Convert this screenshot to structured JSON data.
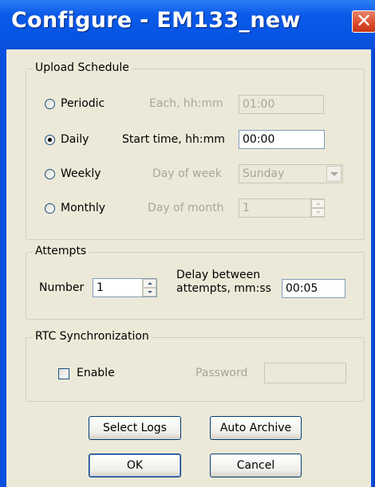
{
  "window": {
    "title": "Configure - EM133_new",
    "close_glyph": "✕"
  },
  "upload_schedule": {
    "title": "Upload Schedule",
    "options": [
      {
        "label": "Periodic",
        "param_label": "Each, hh:mm",
        "value": "01:00",
        "selected": false,
        "enabled": false
      },
      {
        "label": "Daily",
        "param_label": "Start time, hh:mm",
        "value": "00:00",
        "selected": true,
        "enabled": true
      },
      {
        "label": "Weekly",
        "param_label": "Day of week",
        "value": "Sunday",
        "selected": false,
        "enabled": false
      },
      {
        "label": "Monthly",
        "param_label": "Day of month",
        "value": "1",
        "selected": false,
        "enabled": false
      }
    ]
  },
  "attempts": {
    "title": "Attempts",
    "number_label": "Number",
    "number_value": "1",
    "delay_label_line1": "Delay between",
    "delay_label_line2": "attempts, mm:ss",
    "delay_value": "00:05"
  },
  "rtc": {
    "title": "RTC Synchronization",
    "enable_label": "Enable",
    "enable_checked": false,
    "password_label": "Password",
    "password_value": ""
  },
  "buttons": {
    "select_logs": "Select Logs",
    "auto_archive": "Auto Archive",
    "ok": "OK",
    "cancel": "Cancel"
  },
  "colors": {
    "titlebar": "#0655e4",
    "dialog_bg": "#ece9d8",
    "close_button": "#d94a2a",
    "disabled_text": "#a7a69a"
  }
}
